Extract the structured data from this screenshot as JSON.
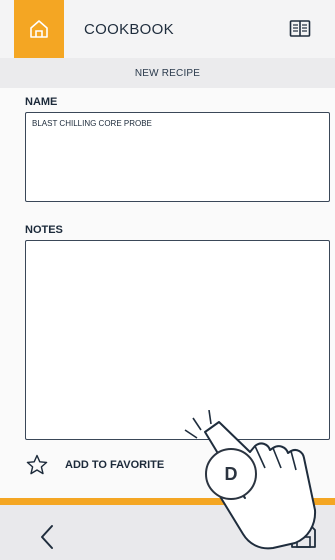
{
  "header": {
    "title": "COOKBOOK",
    "home_icon": "home-icon",
    "book_icon": "book-icon"
  },
  "subheader": {
    "title": "NEW RECIPE"
  },
  "form": {
    "name_label": "NAME",
    "name_value": "BLAST CHILLING CORE PROBE",
    "notes_label": "NOTES",
    "notes_value": ""
  },
  "favorites": {
    "label": "ADD TO FAVORITE",
    "icon": "star-outline-icon"
  },
  "footer": {
    "back_icon": "chevron-left-icon",
    "save_icon": "save-icon"
  },
  "overlay": {
    "badge_letter": "D"
  },
  "colors": {
    "accent": "#f4a623",
    "text": "#1c2a3a",
    "header_bg": "#f4f4f5",
    "footer_bg": "#e9e9ec"
  }
}
